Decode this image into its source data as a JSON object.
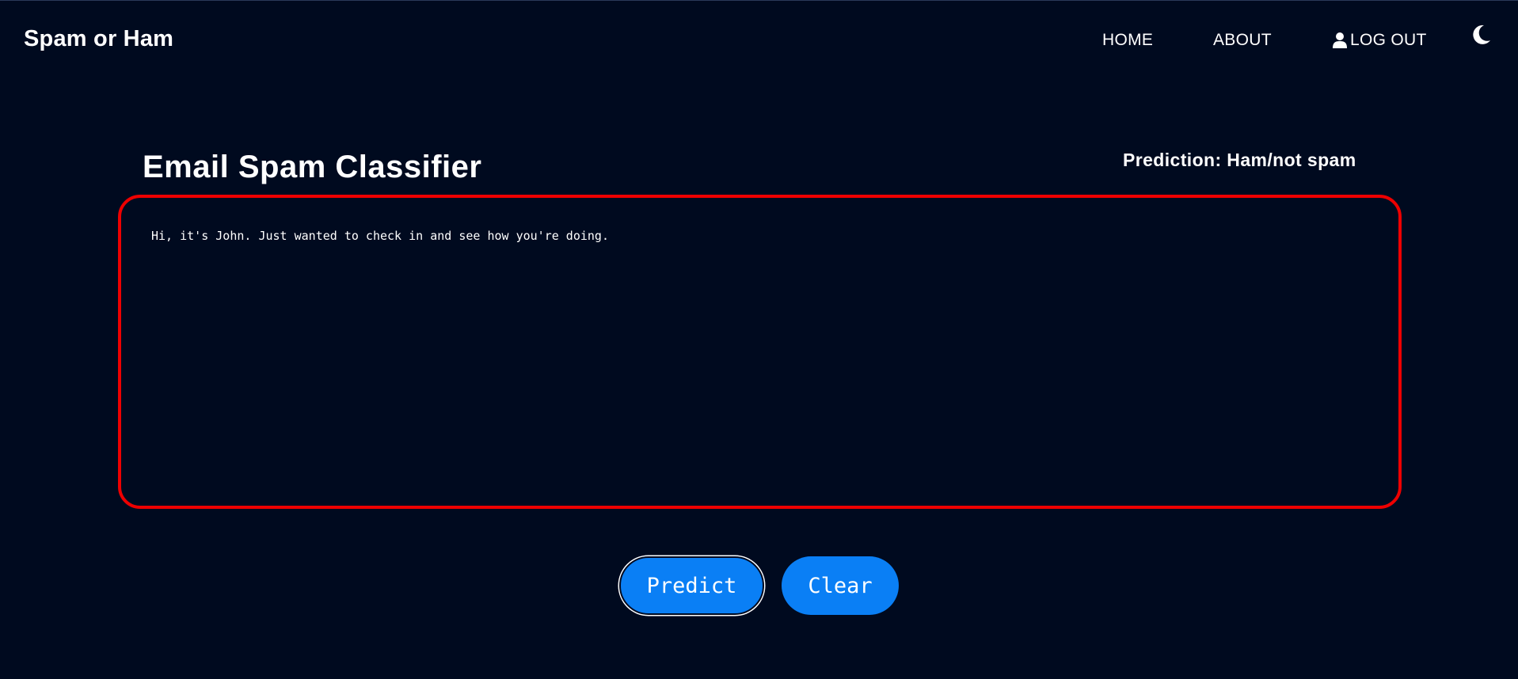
{
  "header": {
    "brand": "Spam or Ham",
    "nav": {
      "home": "HOME",
      "about": "ABOUT",
      "logout": "LOG OUT"
    },
    "icons": {
      "user": "user-icon",
      "theme_toggle": "moon-icon"
    }
  },
  "main": {
    "title": "Email Spam Classifier",
    "prediction": "Prediction: Ham/not spam",
    "email_text": "Hi, it's John. Just wanted to check in and see how you're doing.",
    "buttons": {
      "predict": "Predict",
      "clear": "Clear"
    }
  },
  "colors": {
    "background": "#000a1f",
    "text_box_border": "#ee0000",
    "button": "#0a7ff5",
    "text": "#ffffff"
  }
}
